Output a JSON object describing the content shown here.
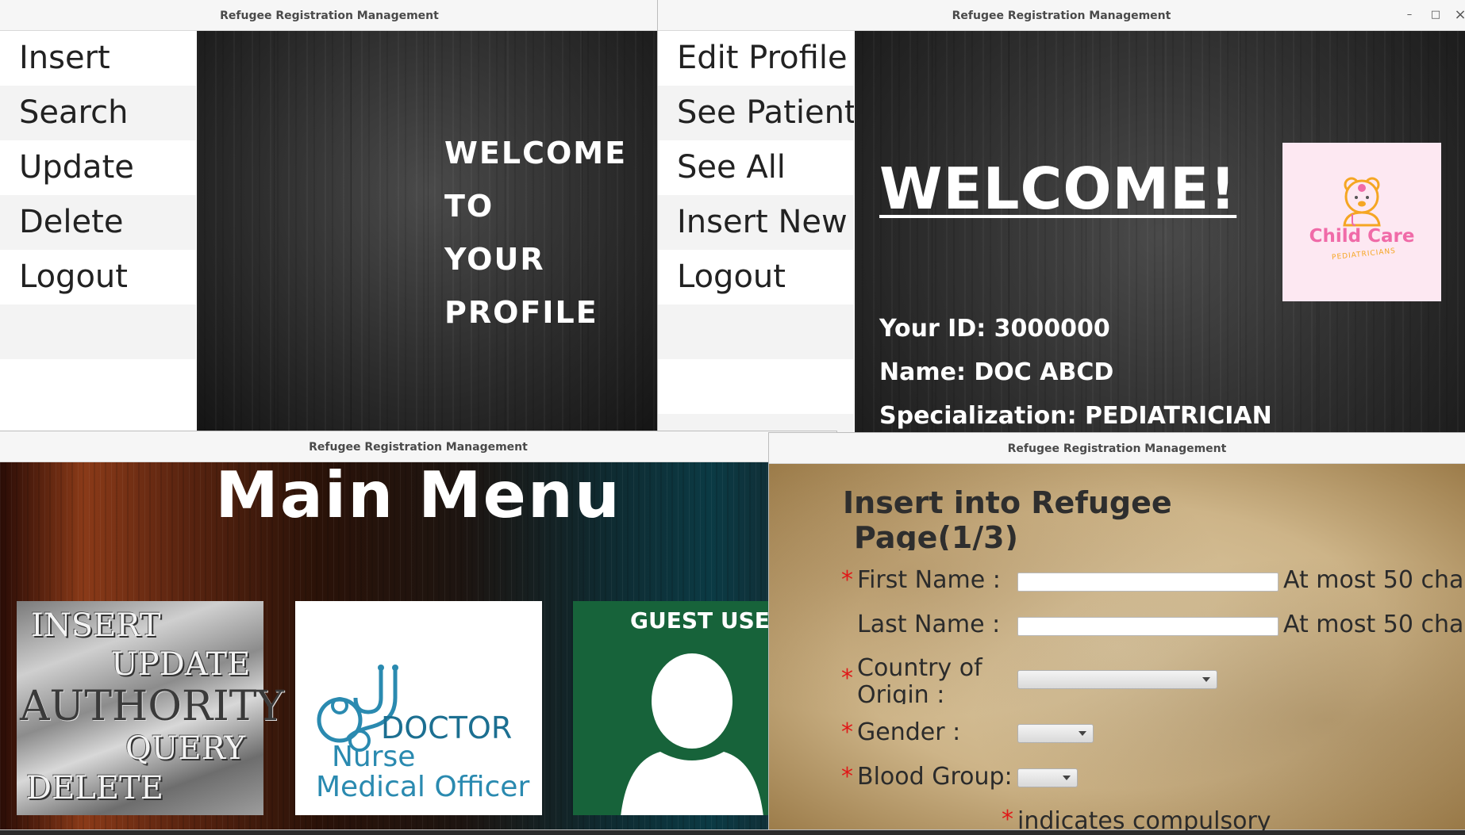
{
  "windows": {
    "profile_window": {
      "title": "Refugee Registration Management",
      "menu": [
        "Insert",
        "Search",
        "Update",
        "Delete",
        "Logout"
      ],
      "welcome": [
        "WELCOME",
        "TO",
        "YOUR",
        "PROFILE"
      ]
    },
    "doctor_window": {
      "title": "Refugee Registration Management",
      "controls": {
        "minimize": "–",
        "maximize": "□",
        "close": "×"
      },
      "menu": [
        "Edit Profile",
        "See Patient",
        "See All",
        "Insert New",
        "Logout"
      ],
      "welcome": "WELCOME!",
      "id_line": "Your ID: 3000000",
      "name_line": "Name: DOC ABCD",
      "spec_line": "Specialization: PEDIATRICIAN",
      "logo": {
        "title": "Child Care",
        "subtitle": "PEDIATRICIANS",
        "bg_color": "#fde8f2",
        "accent_color": "#f06ba8",
        "icon": "teddy-bear-doctor-icon"
      }
    },
    "main_menu_window": {
      "title": "Refugee Registration Management",
      "heading": "Main Menu",
      "tiles": {
        "authority": {
          "insert": "INSERT",
          "update": "UPDATE",
          "authority": "AUTHORITY",
          "query": "QUERY",
          "delete": "DELETE"
        },
        "doctor": {
          "doctor": "DOCTOR",
          "nurse": "Nurse",
          "medical_officer": "Medical Officer",
          "icon": "stethoscope-icon",
          "color": "#2a8ab0"
        },
        "guest": {
          "label": "GUEST USER",
          "icon": "person-silhouette-icon",
          "color": "#17633a"
        }
      }
    },
    "insert_window": {
      "title": "Refugee Registration Management",
      "heading_line1": "Insert into Refugee",
      "heading_line2": "Page(1/3)",
      "first_name_label": "First Name :",
      "last_name_label": "Last Name :",
      "country_label_line1": "Country of",
      "country_label_line2": "Origin :",
      "gender_label": "Gender :",
      "blood_group_label": "Blood Group:",
      "hint": "At most 50 cha",
      "required_mark": "*",
      "footnote": "indicates compulsory",
      "required_color": "#e01818"
    }
  }
}
